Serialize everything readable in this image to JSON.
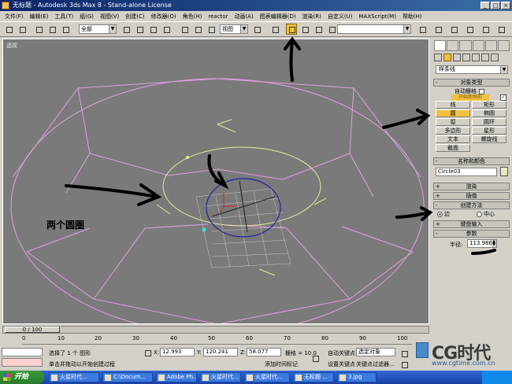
{
  "window": {
    "title": "无标题 - Autodesk 3ds Max 8 - Stand-alone License",
    "min": "_",
    "max": "□",
    "close": "×"
  },
  "menu": [
    "文件(F)",
    "编辑(E)",
    "工具(T)",
    "组(G)",
    "视图(V)",
    "创建(C)",
    "修改器(O)",
    "角色(H)",
    "reactor",
    "动画(A)",
    "图表编辑器(D)",
    "渲染(R)",
    "自定义(U)",
    "MAXScript(M)",
    "帮助(H)"
  ],
  "toolbar": {
    "selection_filter": "全部",
    "ref_coord": "视图",
    "named_sel": ""
  },
  "viewport": {
    "label": "透视",
    "annotation": "两个圆圈"
  },
  "command_panel": {
    "category": "样条线",
    "object_type_title": "对象类型",
    "autogrid_label": "自动栅格",
    "start_new_shape": "开始新图形",
    "shape_buttons": [
      "线",
      "矩形",
      "圆",
      "椭圆",
      "弧",
      "圆环",
      "多边形",
      "星形",
      "文本",
      "螺旋线",
      "截面"
    ],
    "name_color_title": "名称和颜色",
    "object_name": "Circle03",
    "rollouts": {
      "rendering": "渲染",
      "interpolation": "插值",
      "creation_method": "创建方法",
      "keyboard_entry": "键盘输入",
      "parameters": "参数"
    },
    "creation_method": {
      "edge": "边",
      "center": "中心"
    },
    "radius_label": "半径:",
    "radius_value": "113.986"
  },
  "timeline": {
    "slider": "0 / 100",
    "ticks": [
      "0",
      "10",
      "20",
      "30",
      "40",
      "50",
      "60",
      "70",
      "80",
      "90",
      "100"
    ]
  },
  "status": {
    "selected": "选择了 1 个 图形",
    "prompt": "单击并拖动以开始创建过程",
    "x_label": "X:",
    "x_value": "12.993",
    "y_label": "Y:",
    "y_value": "120.241",
    "z_label": "Z:",
    "z_value": "58.077",
    "grid": "栅格 = 10.0",
    "add_time_tag": "添加时间标记",
    "auto_key": "自动关键点",
    "set_key": "设置关键点",
    "selected_obj": "选定对象",
    "key_filters": "关键点过滤器..."
  },
  "taskbar": {
    "start": "开始",
    "tasks": [
      "火星时代...",
      "C:\\Docum...",
      "Adobe Ph...",
      "火星时代...",
      "火星时代...",
      "无标题 ...",
      "3.jpg"
    ]
  },
  "watermark": {
    "logo": "CG时代",
    "url": "www.cgtime.com.cn"
  },
  "colors": {
    "accent": "#f0c040",
    "viewport_bg": "#7a7a7a",
    "selected_circle": "#e8e8a0",
    "pink_lines": "#e0a0e0",
    "blue_circle": "#2020a0",
    "titlebar": "#0a246a"
  }
}
